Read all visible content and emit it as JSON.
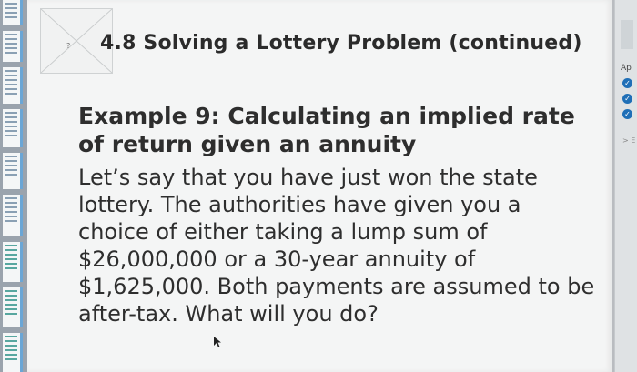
{
  "slide": {
    "logo_symbol": "?",
    "title": "4.8 Solving a Lottery Problem (continued)",
    "example_title": "Example 9: Calculating an implied rate of return given an annuity",
    "body": "Let’s say that you have just won the state lottery. The authorities have given you a choice of either taking a lump sum of $26,000,000 or a 30-year annuity of $1,625,000. Both payments are assumed to be after-tax. What will you do?"
  },
  "right_panel": {
    "label": "Ap",
    "chevron_label": "> E"
  },
  "icons": {
    "check": "checkmark-icon",
    "cursor": "mouse-pointer-icon"
  },
  "colors": {
    "slide_background": "#f4f5f5",
    "text": "#2e2e2e",
    "check_blue": "#1f6fb7"
  }
}
